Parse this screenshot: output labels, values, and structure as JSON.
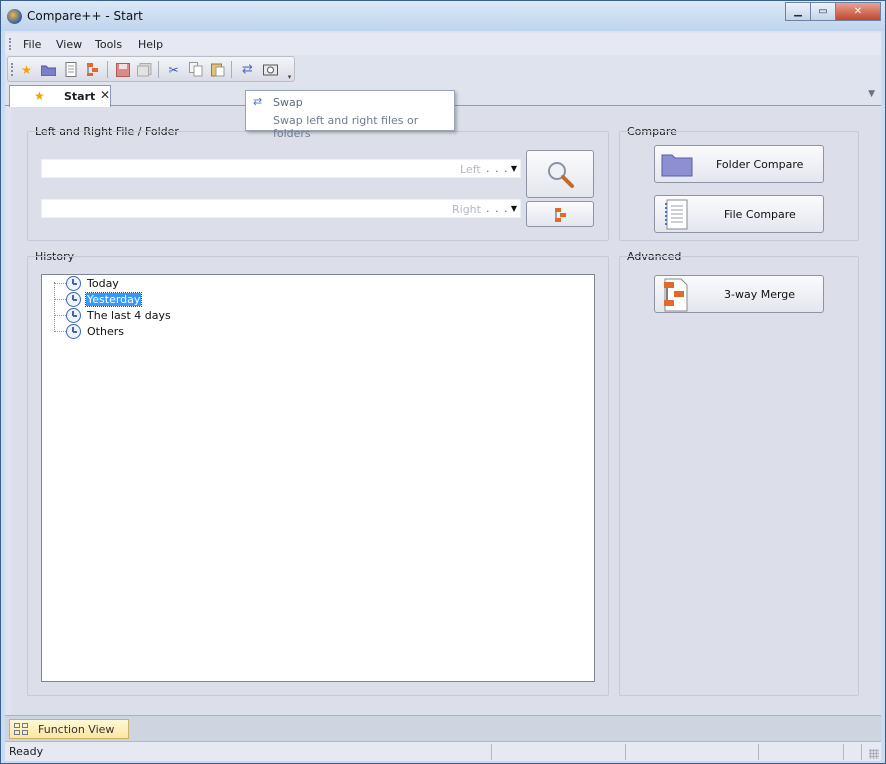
{
  "window": {
    "title": "Compare++ - Start"
  },
  "menu": {
    "items": [
      "File",
      "View",
      "Tools",
      "Help"
    ]
  },
  "toolbar": {
    "buttons": [
      "star-icon",
      "folder-icon",
      "file-icon",
      "merge-icon",
      "save-icon",
      "save-all-icon",
      "cut-icon",
      "copy-icon",
      "paste-icon",
      "swap-icon",
      "snapshot-icon"
    ]
  },
  "tabs": [
    {
      "label": "Start",
      "close": "✕"
    }
  ],
  "tooltip": {
    "title": "Swap",
    "description": "Swap left and right files or folders"
  },
  "file_folder": {
    "section_label": "Left and Right File / Folder",
    "left": {
      "placeholder": "Left",
      "dots": ". . ."
    },
    "right": {
      "placeholder": "Right",
      "dots": ". . ."
    }
  },
  "compare": {
    "section_label": "Compare",
    "folder_compare": "Folder Compare",
    "file_compare": "File Compare"
  },
  "advanced": {
    "section_label": "Advanced",
    "three_way_merge": "3-way Merge"
  },
  "history": {
    "section_label": "History",
    "items": [
      {
        "label": "Today",
        "selected": false
      },
      {
        "label": "Yesterday",
        "selected": true
      },
      {
        "label": "The last 4 days",
        "selected": false
      },
      {
        "label": "Others",
        "selected": false
      }
    ]
  },
  "function_view": {
    "label": "Function View"
  },
  "status": {
    "text": "Ready"
  },
  "colors": {
    "selection": "#3399ff",
    "accent": "#3b67b5",
    "tab_star": "#f2a400"
  }
}
